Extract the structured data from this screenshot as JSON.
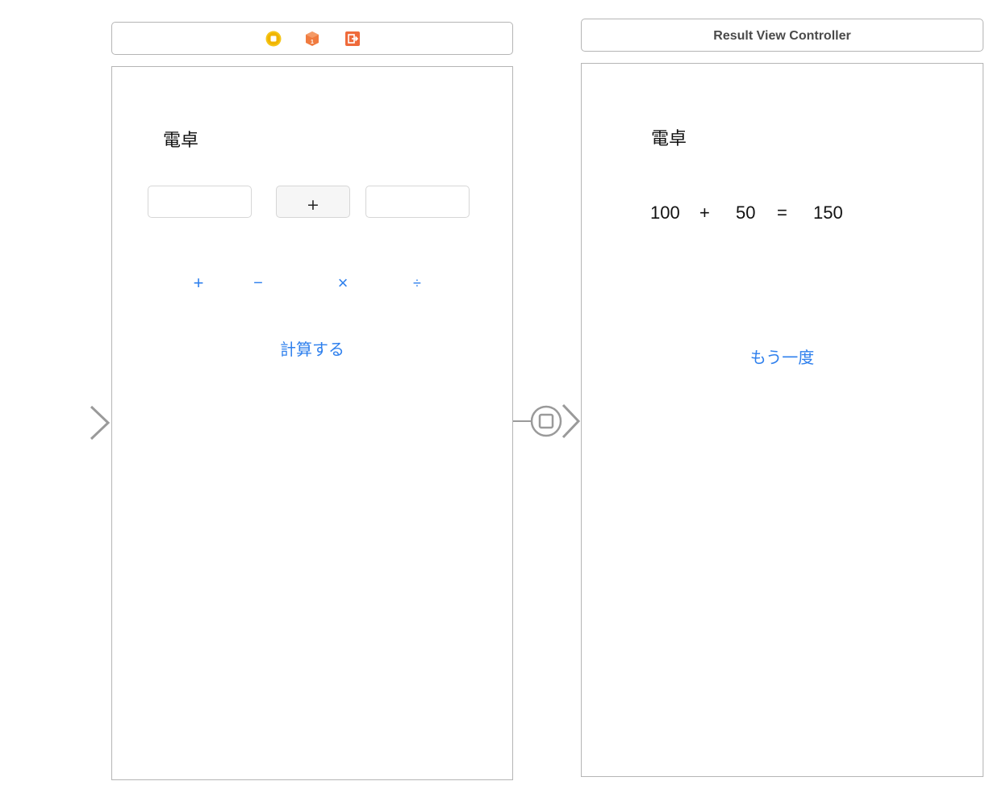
{
  "colors": {
    "accent_blue": "#2f80ed",
    "frame_border": "#b5b5b5",
    "view_controller_icon": "#f5c518",
    "first_responder_icon": "#f07b3f",
    "exit_icon": "#ef6a3a",
    "arrow_gray": "#9a9a9a"
  },
  "left_scene": {
    "dock_icons": [
      "view-controller-icon",
      "first-responder-icon",
      "exit-icon"
    ],
    "title": "電卓",
    "operator_display": "+",
    "operators": {
      "plus": "+",
      "minus": "−",
      "times": "×",
      "divide": "÷"
    },
    "calculate_label": "計算する"
  },
  "right_scene": {
    "header_title": "Result View Controller",
    "title": "電卓",
    "expression": {
      "operand_a": "100",
      "operator": "+",
      "operand_b": "50",
      "equals": "=",
      "result": "150"
    },
    "retry_label": "もう一度"
  },
  "segue": {
    "icon": "modal-segue-icon"
  },
  "entry_point": {
    "icon": "initial-view-controller-arrow-icon"
  }
}
